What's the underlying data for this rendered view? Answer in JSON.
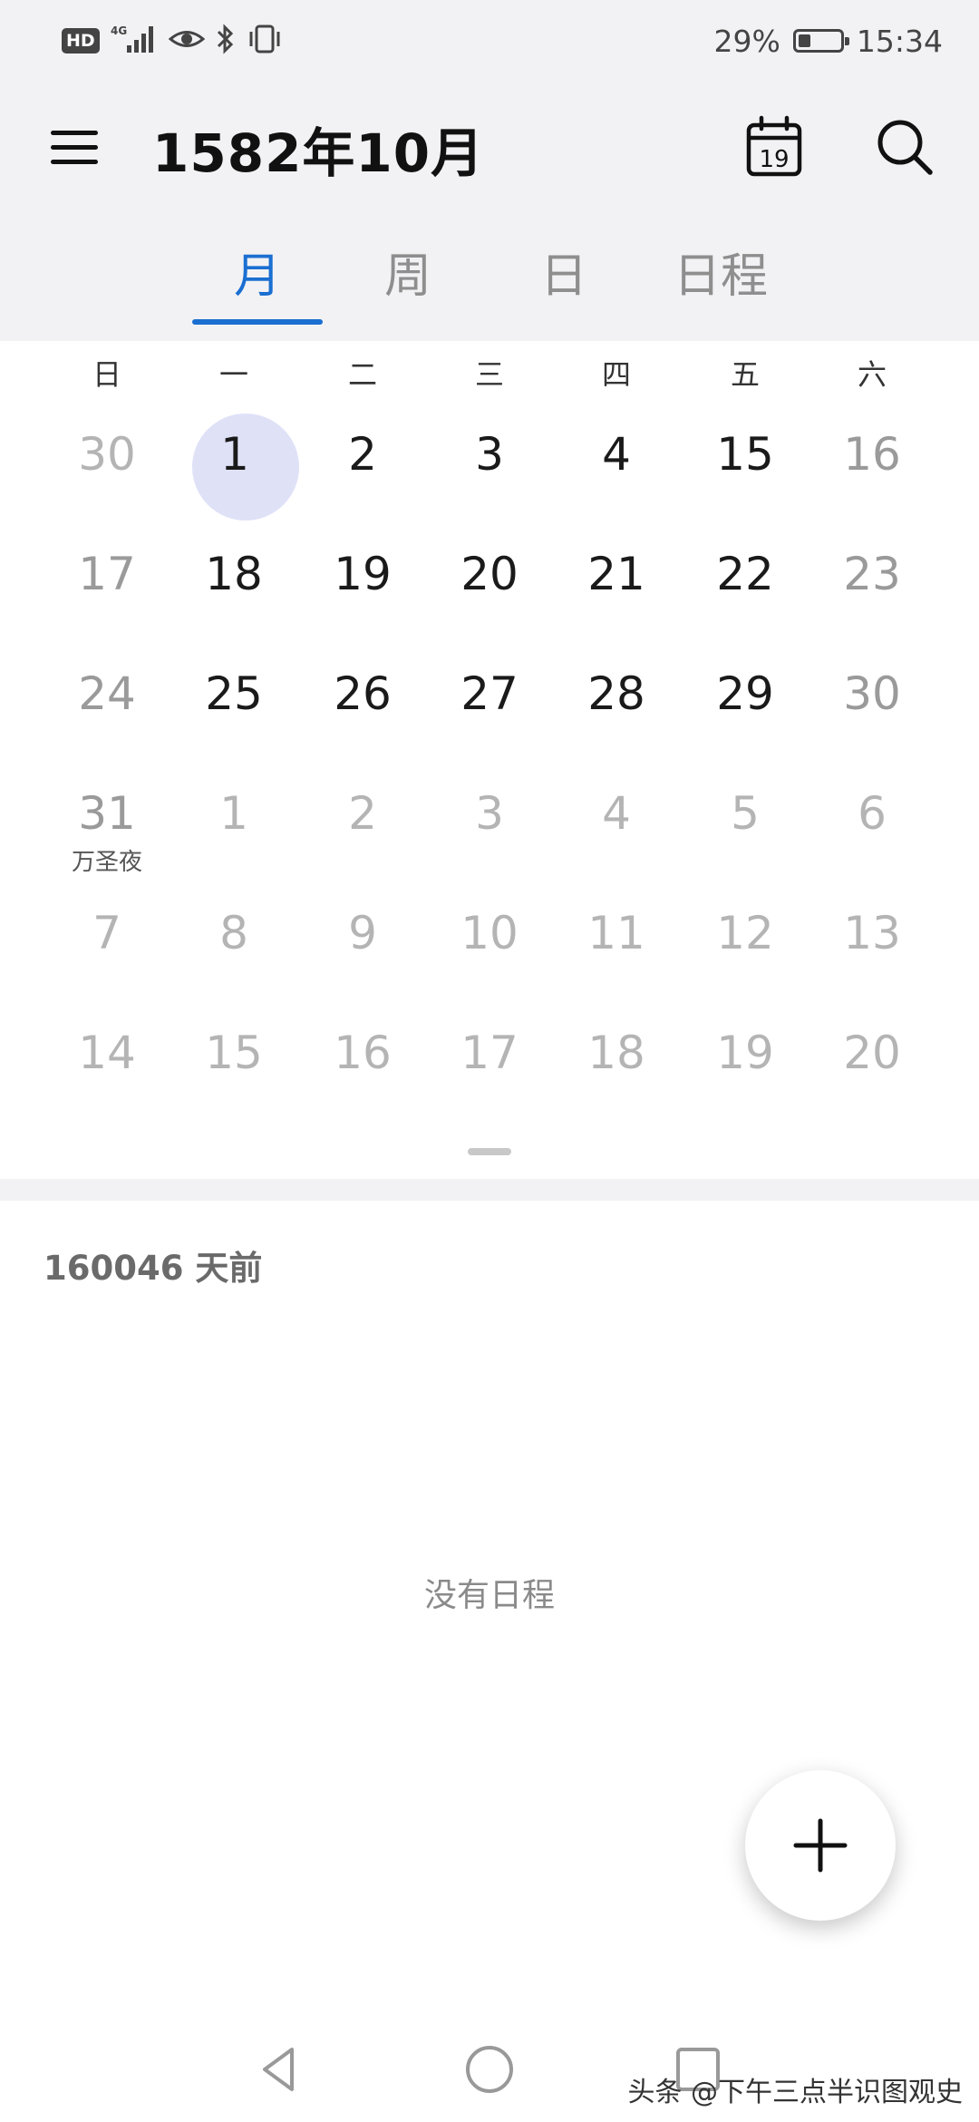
{
  "status_bar": {
    "hd_badge": "HD",
    "network": "4G",
    "battery_percent": "29%",
    "battery_level": 0.29,
    "time": "15:34",
    "icons": [
      "hd-icon",
      "signal-icon",
      "eye-icon",
      "bluetooth-icon",
      "vibrate-icon",
      "battery-icon"
    ]
  },
  "header": {
    "title": "1582年10月",
    "today_icon_day": "19",
    "icons": [
      "menu-icon",
      "today-calendar-icon",
      "search-icon"
    ]
  },
  "tabs": [
    {
      "label": "月",
      "active": true
    },
    {
      "label": "周",
      "active": false
    },
    {
      "label": "日",
      "active": false
    },
    {
      "label": "日程",
      "active": false
    }
  ],
  "weekdays": [
    "日",
    "一",
    "二",
    "三",
    "四",
    "五",
    "六"
  ],
  "weeks": [
    [
      {
        "d": "30",
        "t": "other"
      },
      {
        "d": "1",
        "t": "sel"
      },
      {
        "d": "2",
        "t": "cur"
      },
      {
        "d": "3",
        "t": "cur"
      },
      {
        "d": "4",
        "t": "cur"
      },
      {
        "d": "15",
        "t": "cur"
      },
      {
        "d": "16",
        "t": "weekend"
      }
    ],
    [
      {
        "d": "17",
        "t": "weekend"
      },
      {
        "d": "18",
        "t": "cur"
      },
      {
        "d": "19",
        "t": "cur"
      },
      {
        "d": "20",
        "t": "cur"
      },
      {
        "d": "21",
        "t": "cur"
      },
      {
        "d": "22",
        "t": "cur"
      },
      {
        "d": "23",
        "t": "weekend"
      }
    ],
    [
      {
        "d": "24",
        "t": "weekend"
      },
      {
        "d": "25",
        "t": "cur"
      },
      {
        "d": "26",
        "t": "cur"
      },
      {
        "d": "27",
        "t": "cur"
      },
      {
        "d": "28",
        "t": "cur"
      },
      {
        "d": "29",
        "t": "cur"
      },
      {
        "d": "30",
        "t": "weekend"
      }
    ],
    [
      {
        "d": "31",
        "t": "weekend",
        "sub": "万圣夜"
      },
      {
        "d": "1",
        "t": "other"
      },
      {
        "d": "2",
        "t": "other"
      },
      {
        "d": "3",
        "t": "other"
      },
      {
        "d": "4",
        "t": "other"
      },
      {
        "d": "5",
        "t": "other"
      },
      {
        "d": "6",
        "t": "other"
      }
    ],
    [
      {
        "d": "7",
        "t": "other"
      },
      {
        "d": "8",
        "t": "other"
      },
      {
        "d": "9",
        "t": "other"
      },
      {
        "d": "10",
        "t": "other"
      },
      {
        "d": "11",
        "t": "other"
      },
      {
        "d": "12",
        "t": "other"
      },
      {
        "d": "13",
        "t": "other"
      }
    ],
    [
      {
        "d": "14",
        "t": "other"
      },
      {
        "d": "15",
        "t": "other"
      },
      {
        "d": "16",
        "t": "other"
      },
      {
        "d": "17",
        "t": "other"
      },
      {
        "d": "18",
        "t": "other"
      },
      {
        "d": "19",
        "t": "other"
      },
      {
        "d": "20",
        "t": "other"
      }
    ]
  ],
  "agenda": {
    "days_ago": "160046 天前",
    "empty_text": "没有日程"
  },
  "fab_icon": "plus-icon",
  "nav_icons": [
    "back-icon",
    "home-icon",
    "recents-icon"
  ],
  "watermark": "头条 @下午三点半识图观史",
  "colors": {
    "accent": "#1a6fd1",
    "selected_day_bg": "#dfe1f7",
    "header_bg": "#f2f2f4"
  }
}
